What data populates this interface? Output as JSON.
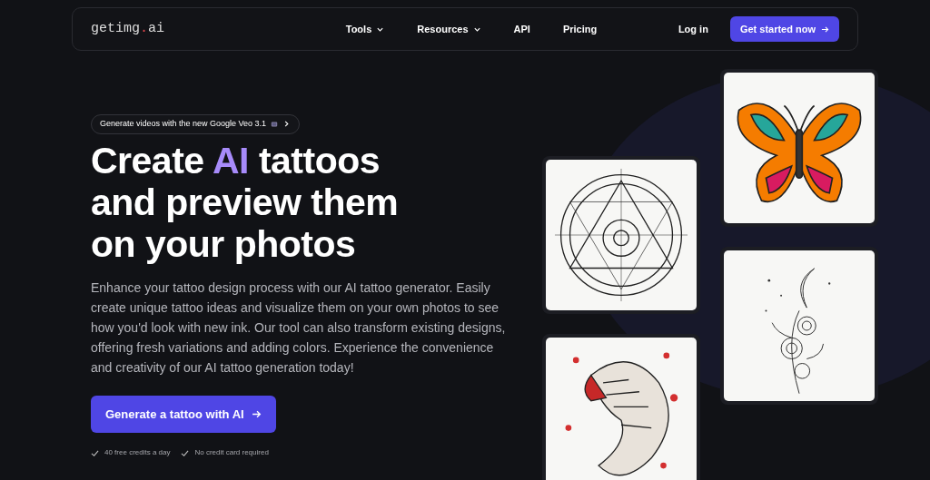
{
  "navbar": {
    "logo": {
      "name": "getimg",
      "dot": ".",
      "suffix": "ai"
    },
    "links": [
      {
        "label": "Tools",
        "dropdown": true
      },
      {
        "label": "Resources",
        "dropdown": true
      },
      {
        "label": "API",
        "dropdown": false
      },
      {
        "label": "Pricing",
        "dropdown": false
      }
    ],
    "login": "Log in",
    "cta": "Get started now"
  },
  "hero": {
    "announcement": "Generate videos with the new Google Veo 3.1",
    "headline": "Create **AI** tattoos and preview them on your photos",
    "description": "Enhance your tattoo design process with our AI tattoo generator. Easily create unique tattoo ideas and visualize them on your own photos to see how you'd look with new ink. Our tool can also transform existing designs, offering fresh variations and adding colors. Experience the convenience and creativity of our AI tattoo generation today!",
    "button": "Generate a tattoo with AI",
    "perks": [
      "40 free credits a day",
      "No credit card required"
    ]
  },
  "gallery": [
    [
      {
        "kind": "geometric"
      },
      {
        "kind": "tiger"
      }
    ],
    [
      {
        "kind": "butterfly"
      },
      {
        "kind": "floral"
      }
    ]
  ]
}
